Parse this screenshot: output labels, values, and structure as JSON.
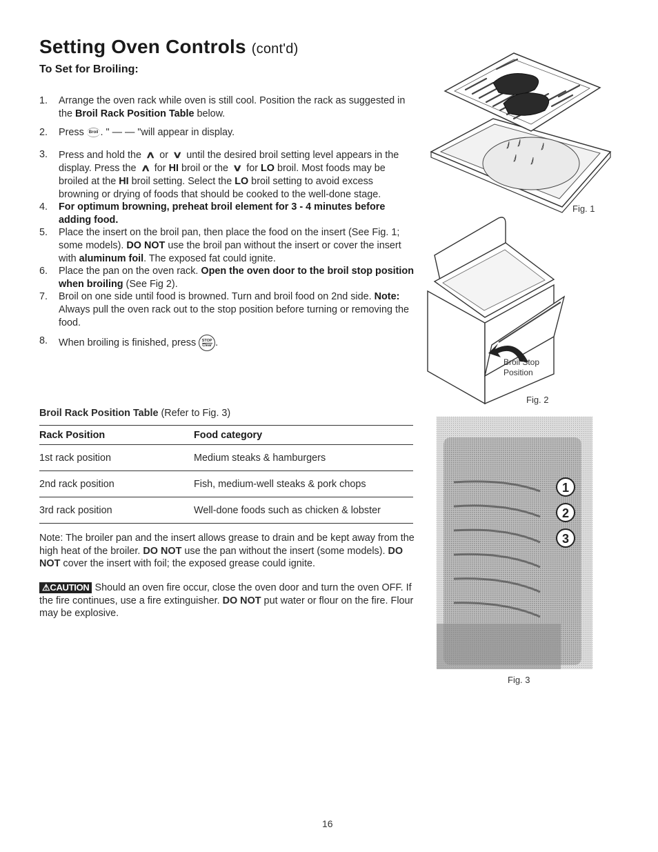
{
  "header": {
    "title": "Setting Oven Controls",
    "title_suffix": "(cont'd)",
    "section": "To Set for Broiling:"
  },
  "steps": [
    {
      "num": "1.",
      "parts": [
        {
          "t": "Arrange the oven rack while oven is still cool. Position the rack as suggested in the "
        },
        {
          "t": "Broil Rack Position Table",
          "b": true
        },
        {
          "t": " below."
        }
      ]
    },
    {
      "num": "2.",
      "parts": [
        {
          "t": "Press "
        },
        {
          "icon": "broil-button",
          "label": "Broil"
        },
        {
          "t": ". \" — — \"will appear in display."
        }
      ]
    },
    {
      "num": "3.",
      "parts": [
        {
          "t": "Press and hold the "
        },
        {
          "icon": "up-arrow",
          "label": "⌃"
        },
        {
          "t": " or "
        },
        {
          "icon": "down-arrow",
          "label": "⌄"
        },
        {
          "t": " until the desired broil setting level appears in the display. Press the "
        },
        {
          "icon": "up-arrow",
          "label": "⌃"
        },
        {
          "t": " for "
        },
        {
          "t": "HI",
          "b": true
        },
        {
          "t": " broil or the "
        },
        {
          "icon": "down-arrow",
          "label": "⌄"
        },
        {
          "t": " for "
        },
        {
          "t": "LO",
          "b": true
        },
        {
          "t": " broil. Most foods may be broiled at the "
        },
        {
          "t": "HI",
          "b": true
        },
        {
          "t": " broil setting. Select the "
        },
        {
          "t": "LO",
          "b": true
        },
        {
          "t": " broil setting to avoid excess browning or drying of foods that should be cooked to the well-done stage."
        }
      ]
    },
    {
      "num": "4.",
      "parts": [
        {
          "t": "For optimum browning, preheat broil element for 3 - 4 minutes before adding food.",
          "b": true
        }
      ]
    },
    {
      "num": "5.",
      "parts": [
        {
          "t": "Place the insert on the broil pan, then place the food on the insert (See Fig. 1; some models). "
        },
        {
          "t": "DO NOT",
          "b": true
        },
        {
          "t": " use the broil pan without the insert or cover the insert with "
        },
        {
          "t": "aluminum foil",
          "b": true
        },
        {
          "t": ". The exposed fat could ignite."
        }
      ]
    },
    {
      "num": "6.",
      "parts": [
        {
          "t": "Place the pan on the oven rack. "
        },
        {
          "t": "Open the oven door to the broil stop position when broiling",
          "b": true
        },
        {
          "t": " (See Fig 2)."
        }
      ]
    },
    {
      "num": "7.",
      "parts": [
        {
          "t": "Broil on one side until food is browned. Turn and broil food on 2nd side. "
        },
        {
          "t": "Note:",
          "b": true
        },
        {
          "t": " Always pull the oven rack out to the stop position before turning or removing the food."
        }
      ]
    },
    {
      "num": "8.",
      "parts": [
        {
          "t": "When broiling is finished, press "
        },
        {
          "icon": "stop-clear-button",
          "label": "STOP/Clear"
        },
        {
          "t": "."
        }
      ]
    }
  ],
  "table": {
    "caption_bold": "Broil Rack Position Table",
    "caption_rest": " (Refer to Fig. 3)",
    "headers": [
      "Rack Position",
      "Food category"
    ],
    "rows": [
      [
        "1st rack position",
        "Medium steaks & hamburgers"
      ],
      [
        "2nd rack position",
        "Fish, medium-well steaks & pork chops"
      ],
      [
        "3rd rack position",
        "Well-done foods such as chicken & lobster"
      ]
    ]
  },
  "note": [
    {
      "t": "Note: The broiler pan and the insert allows grease to drain and be kept away from the high heat of the broiler. "
    },
    {
      "t": "DO NOT",
      "b": true
    },
    {
      "t": " use the pan without the insert (some models). "
    },
    {
      "t": "DO NOT",
      "b": true
    },
    {
      "t": " cover the insert with foil; the exposed grease could ignite."
    }
  ],
  "caution": {
    "badge": "CAUTION",
    "parts": [
      {
        "t": " Should an oven fire occur, close the oven door and turn the oven OFF. If the fire continues, use a fire extinguisher. "
      },
      {
        "t": "DO NOT",
        "b": true
      },
      {
        "t": " put water or flour on the fire. Flour may be explosive."
      }
    ]
  },
  "figures": {
    "fig1_label": "Fig. 1",
    "fig2_label": "Fig. 2",
    "fig2_callout_line1": "Broil Stop",
    "fig2_callout_line2": "Position",
    "fig3_label": "Fig. 3",
    "fig3_positions": [
      "1",
      "2",
      "3"
    ]
  },
  "page_number": "16"
}
